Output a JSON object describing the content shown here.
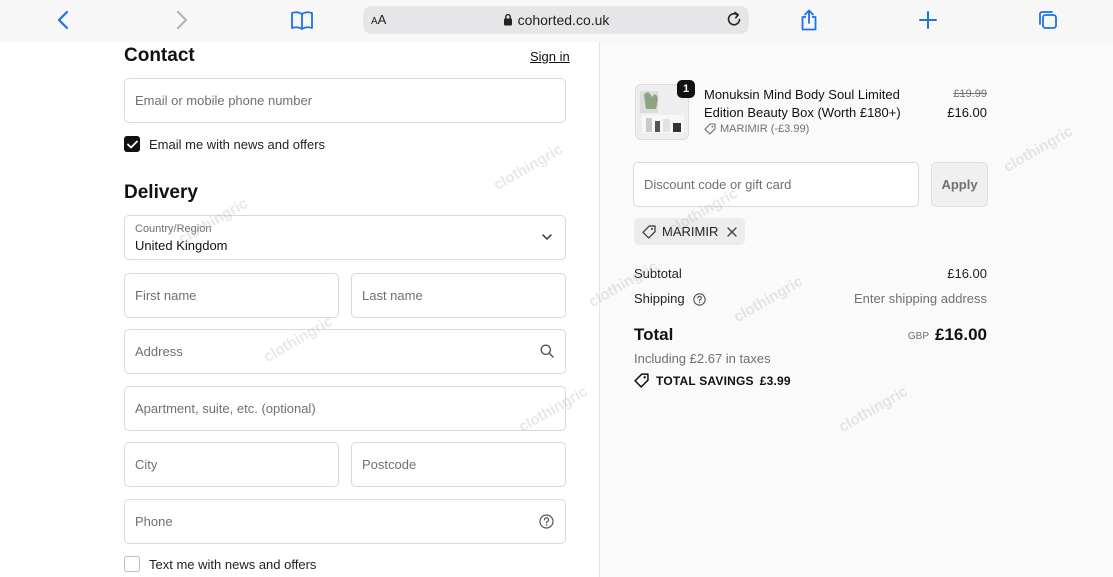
{
  "browser": {
    "aa_label_small": "A",
    "aa_label_large": "A",
    "url": "cohorted.co.uk"
  },
  "contact": {
    "title": "Contact",
    "sign_in": "Sign in",
    "email_placeholder": "Email or mobile phone number",
    "news_label": "Email me with news and offers",
    "news_checked": true
  },
  "delivery": {
    "title": "Delivery",
    "country_label": "Country/Region",
    "country_value": "United Kingdom",
    "first_name": "First name",
    "last_name": "Last name",
    "address": "Address",
    "apartment": "Apartment, suite, etc. (optional)",
    "city": "City",
    "postcode": "Postcode",
    "phone": "Phone",
    "sms_label": "Text me with news and offers",
    "sms_checked": false
  },
  "summary": {
    "item": {
      "quantity": "1",
      "name": "Monuksin Mind Body Soul Limited Edition Beauty Box (Worth £180+)",
      "discount": "MARIMIR (-£3.99)",
      "original_price": "£19.99",
      "price": "£16.00"
    },
    "discount_placeholder": "Discount code or gift card",
    "apply_label": "Apply",
    "applied_code": "MARIMIR",
    "subtotal_label": "Subtotal",
    "subtotal_value": "£16.00",
    "shipping_label": "Shipping",
    "shipping_value": "Enter shipping address",
    "total_label": "Total",
    "total_currency": "GBP",
    "total_value": "£16.00",
    "taxes_note": "Including £2.67 in taxes",
    "savings_label": "TOTAL SAVINGS",
    "savings_value": "£3.99"
  },
  "watermark": "clothingric",
  "colors": {
    "accent_blue": "#1a73e8",
    "text": "#1a1a1a",
    "muted": "#707070",
    "border": "#d9d9d9"
  }
}
